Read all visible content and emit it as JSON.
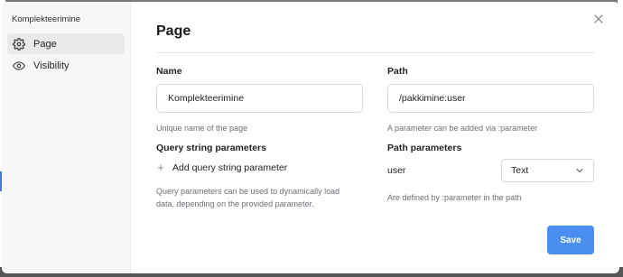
{
  "sidebar": {
    "title": "Komplekteerimine",
    "items": [
      {
        "label": "Page",
        "icon": "gear-icon",
        "active": true
      },
      {
        "label": "Visibility",
        "icon": "eye-icon",
        "active": false
      }
    ]
  },
  "main": {
    "title": "Page",
    "name": {
      "label": "Name",
      "value": "Komplekteerimine",
      "help": "Unique name of the page"
    },
    "path": {
      "label": "Path",
      "value": "/pakkimine:user",
      "help": "A parameter can be added via :parameter"
    },
    "query": {
      "label": "Query string parameters",
      "add_label": "Add query string parameter",
      "help": "Query parameters can be used to dynamically load data, depending on the provided parameter."
    },
    "path_params": {
      "label": "Path parameters",
      "items": [
        {
          "name": "user",
          "type": "Text"
        }
      ],
      "help": "Are defined by :parameter in the path"
    },
    "save_label": "Save"
  },
  "colors": {
    "accent": "#4a8ff0",
    "sidebar_bg": "#f7f7f8"
  }
}
